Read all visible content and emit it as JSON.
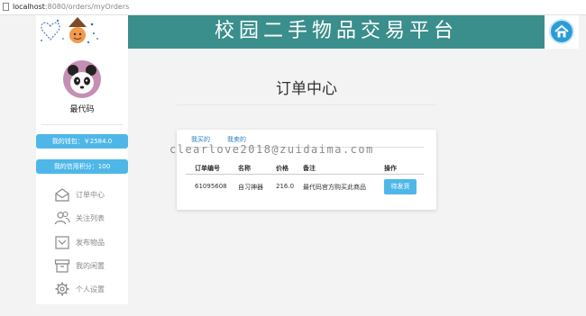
{
  "browser": {
    "url_host": "localhost",
    "url_path": ":8080/orders/myOrders"
  },
  "header": {
    "title": "校园二手物品交易平台"
  },
  "sidebar": {
    "username": "最代码",
    "wallet_label": "我的钱包：￥2584.0",
    "credit_label": "我的信用积分：100",
    "nav": [
      {
        "label": "订单中心",
        "icon": "envelope-open-icon"
      },
      {
        "label": "关注列表",
        "icon": "users-icon"
      },
      {
        "label": "发布物品",
        "icon": "inbox-icon"
      },
      {
        "label": "我的闲置",
        "icon": "archive-box-icon"
      },
      {
        "label": "个人设置",
        "icon": "gear-icon"
      }
    ]
  },
  "main": {
    "page_title": "订单中心",
    "tabs": [
      {
        "label": "我买的"
      },
      {
        "label": "我卖的"
      }
    ],
    "watermark": "clearlove2018@zuidaima.com",
    "columns": [
      "订单编号",
      "名称",
      "价格",
      "备注",
      "操作"
    ],
    "rows": [
      {
        "order_no": "61095608",
        "name": "自习神器",
        "price": "216.0",
        "note": "最代码官方购买此商品",
        "action": "待发货"
      }
    ]
  },
  "colors": {
    "header_bg": "#3a8f8c",
    "accent_blue": "#4fb7e8",
    "link_blue": "#2b7fc4",
    "home_icon": "#2b9cd8"
  }
}
